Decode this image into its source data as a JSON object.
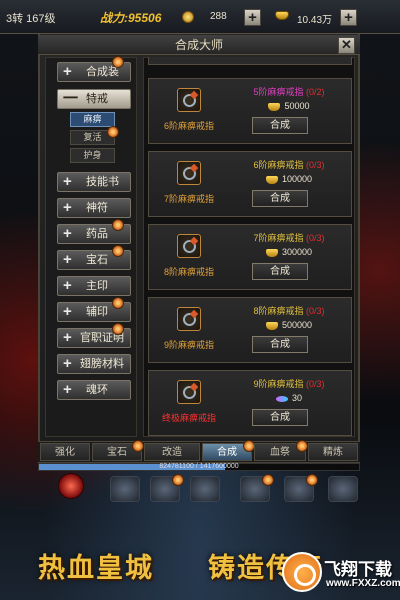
{
  "status": {
    "level": "3转 167级",
    "power": "战力:95506",
    "gold": "288",
    "ingot": "10.43万",
    "plus": "+"
  },
  "panel": {
    "title": "合成大师",
    "categories": [
      {
        "sign": "+",
        "label": "合成装"
      },
      {
        "sign": "一",
        "label": "特戒"
      },
      {
        "sign": "+",
        "label": "技能书"
      },
      {
        "sign": "+",
        "label": "神符"
      },
      {
        "sign": "+",
        "label": "药品"
      },
      {
        "sign": "+",
        "label": "宝石"
      },
      {
        "sign": "+",
        "label": "主印"
      },
      {
        "sign": "+",
        "label": "辅印"
      },
      {
        "sign": "+",
        "label": "官职证明"
      },
      {
        "sign": "+",
        "label": "翅膀材料"
      },
      {
        "sign": "+",
        "label": "魂环"
      }
    ],
    "subitems": [
      "麻痹",
      "复活",
      "护身"
    ],
    "recipes": [
      {
        "item": "6阶麻痹戒指",
        "req_name": "5阶麻痹戒指",
        "req_count": "(0/2)",
        "cost": "50000",
        "button": "合成"
      },
      {
        "item": "7阶麻痹戒指",
        "req_name": "6阶麻痹戒指",
        "req_count": "(0/3)",
        "cost": "100000",
        "button": "合成"
      },
      {
        "item": "8阶麻痹戒指",
        "req_name": "7阶麻痹戒指",
        "req_count": "(0/3)",
        "cost": "300000",
        "button": "合成"
      },
      {
        "item": "9阶麻痹戒指",
        "req_name": "8阶麻痹戒指",
        "req_count": "(0/3)",
        "cost": "500000",
        "button": "合成"
      },
      {
        "item": "终极麻痹戒指",
        "req_name": "9阶麻痹戒指",
        "req_count": "(0/3)",
        "cost": "30",
        "button": "合成"
      }
    ]
  },
  "tabs": [
    "强化",
    "宝石",
    "改造",
    "合成",
    "血祭",
    "精炼"
  ],
  "exp": {
    "text": "824781100 / 1417600000",
    "fraction": 0.58
  },
  "banner": {
    "left": "热血皇城",
    "right": "铸造传奇"
  },
  "watermark": {
    "name": "飞翔下载",
    "url": "www.FXXZ.com"
  }
}
